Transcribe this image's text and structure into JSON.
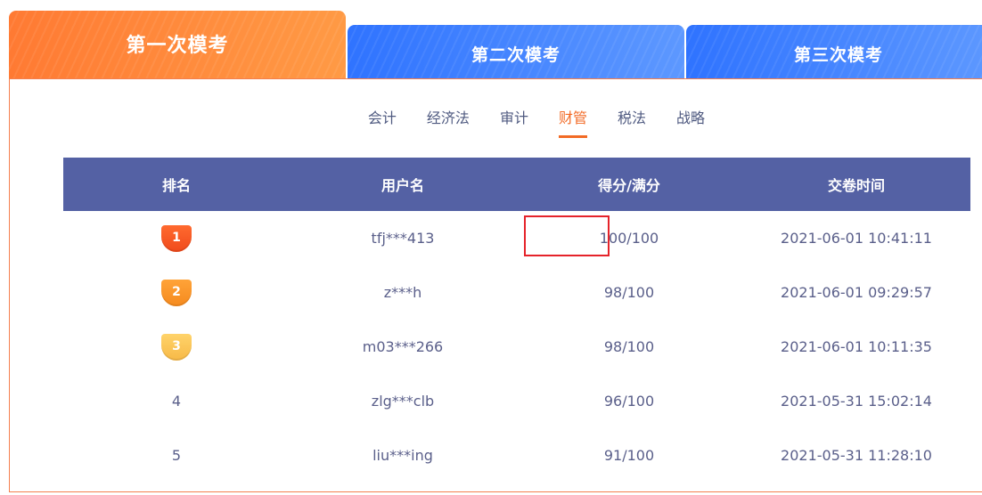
{
  "tabs": [
    {
      "label": "第一次模考",
      "active": true
    },
    {
      "label": "第二次模考",
      "active": false
    },
    {
      "label": "第三次模考",
      "active": false
    }
  ],
  "subjects": [
    {
      "label": "会计"
    },
    {
      "label": "经济法"
    },
    {
      "label": "审计"
    },
    {
      "label": "财管",
      "active": true
    },
    {
      "label": "税法"
    },
    {
      "label": "战略"
    }
  ],
  "table": {
    "headers": [
      "排名",
      "用户名",
      "得分/满分",
      "交卷时间"
    ],
    "rows": [
      {
        "rank": "1",
        "user": "tfj***413",
        "score": "100/100",
        "time": "2021-06-01 10:41:11"
      },
      {
        "rank": "2",
        "user": "z***h",
        "score": "98/100",
        "time": "2021-06-01 09:29:57"
      },
      {
        "rank": "3",
        "user": "m03***266",
        "score": "98/100",
        "time": "2021-06-01 10:11:35"
      },
      {
        "rank": "4",
        "user": "zlg***clb",
        "score": "96/100",
        "time": "2021-05-31 15:02:14"
      },
      {
        "rank": "5",
        "user": "liu***ing",
        "score": "91/100",
        "time": "2021-05-31 11:28:10"
      }
    ]
  },
  "colors": {
    "active_tab": "#ff8a3d",
    "inactive_tab": "#3f80ff",
    "header_bg": "#5461a4",
    "accent": "#f26a25",
    "highlight": "#e5232a"
  }
}
